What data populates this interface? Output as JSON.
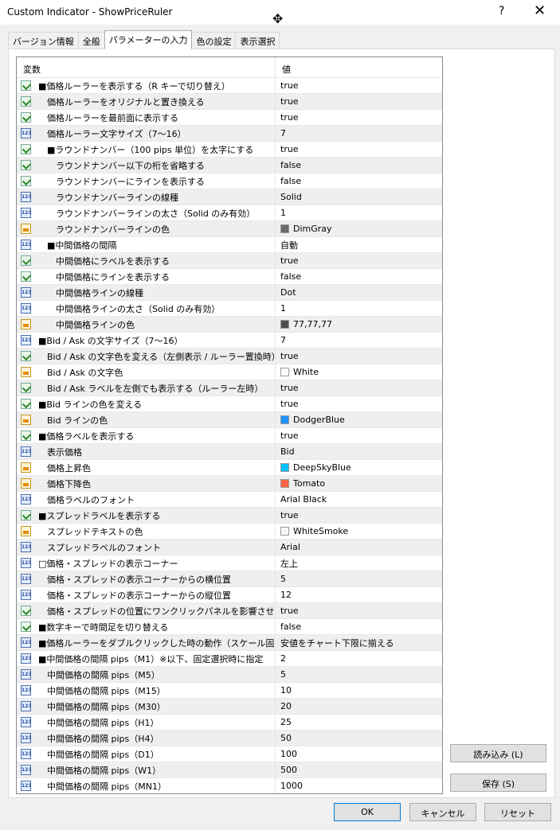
{
  "window": {
    "title": "Custom Indicator - ShowPriceRuler",
    "help_label": "?",
    "close_label": "✕"
  },
  "tabs": [
    {
      "label": "バージョン情報"
    },
    {
      "label": "全般"
    },
    {
      "label": "パラメーターの入力"
    },
    {
      "label": "色の設定"
    },
    {
      "label": "表示選択"
    }
  ],
  "active_tab": 2,
  "grid": {
    "header_variable": "変数",
    "header_value": "値",
    "rows": [
      {
        "icon": "bool-icon",
        "indent": 0,
        "name": "■価格ルーラーを表示する（R キーで切り替え）",
        "value": "true"
      },
      {
        "icon": "bool-icon",
        "indent": 1,
        "name": "価格ルーラーをオリジナルと置き換える",
        "value": "true"
      },
      {
        "icon": "bool-icon",
        "indent": 1,
        "name": "価格ルーラーを最前面に表示する",
        "value": "true"
      },
      {
        "icon": "number-icon",
        "indent": 1,
        "name": "価格ルーラー文字サイズ（7〜16）",
        "value": "7"
      },
      {
        "icon": "bool-icon",
        "indent": 1,
        "name": "■ラウンドナンバー（100 pips 単位）を太字にする",
        "value": "true"
      },
      {
        "icon": "bool-icon",
        "indent": 2,
        "name": "ラウンドナンバー以下の桁を省略する",
        "value": "false"
      },
      {
        "icon": "bool-icon",
        "indent": 2,
        "name": "ラウンドナンバーにラインを表示する",
        "value": "false"
      },
      {
        "icon": "number-icon",
        "indent": 2,
        "name": "ラウンドナンバーラインの線種",
        "value": "Solid"
      },
      {
        "icon": "number-icon",
        "indent": 2,
        "name": "ラウンドナンバーラインの太さ（Solid のみ有効）",
        "value": "1"
      },
      {
        "icon": "color-icon",
        "indent": 2,
        "name": "ラウンドナンバーラインの色",
        "value": "DimGray",
        "swatch": "#696969"
      },
      {
        "icon": "number-icon",
        "indent": 1,
        "name": "■中間価格の間隔",
        "value": "自動"
      },
      {
        "icon": "bool-icon",
        "indent": 2,
        "name": "中間価格にラベルを表示する",
        "value": "true"
      },
      {
        "icon": "bool-icon",
        "indent": 2,
        "name": "中間価格にラインを表示する",
        "value": "false"
      },
      {
        "icon": "number-icon",
        "indent": 2,
        "name": "中間価格ラインの線種",
        "value": "Dot"
      },
      {
        "icon": "number-icon",
        "indent": 2,
        "name": "中間価格ラインの太さ（Solid のみ有効）",
        "value": "1"
      },
      {
        "icon": "color-icon",
        "indent": 2,
        "name": "中間価格ラインの色",
        "value": "77,77,77",
        "swatch": "#4d4d4d"
      },
      {
        "icon": "number-icon",
        "indent": 0,
        "name": "■Bid / Ask の文字サイズ（7〜16）",
        "value": "7"
      },
      {
        "icon": "bool-icon",
        "indent": 1,
        "name": "Bid / Ask の文字色を変える（左側表示 / ルーラー置換時）",
        "value": "true"
      },
      {
        "icon": "color-icon",
        "indent": 1,
        "name": "Bid / Ask の文字色",
        "value": "White",
        "swatch": "#ffffff"
      },
      {
        "icon": "bool-icon",
        "indent": 1,
        "name": "Bid / Ask ラベルを左側でも表示する（ルーラー左時）",
        "value": "true"
      },
      {
        "icon": "bool-icon",
        "indent": 0,
        "name": "■Bid ラインの色を変える",
        "value": "true"
      },
      {
        "icon": "color-icon",
        "indent": 1,
        "name": "Bid ラインの色",
        "value": "DodgerBlue",
        "swatch": "#1e90ff"
      },
      {
        "icon": "bool-icon",
        "indent": 0,
        "name": "■価格ラベルを表示する",
        "value": "true"
      },
      {
        "icon": "number-icon",
        "indent": 1,
        "name": "表示価格",
        "value": "Bid"
      },
      {
        "icon": "color-icon",
        "indent": 1,
        "name": "価格上昇色",
        "value": "DeepSkyBlue",
        "swatch": "#00bfff"
      },
      {
        "icon": "color-icon",
        "indent": 1,
        "name": "価格下降色",
        "value": "Tomato",
        "swatch": "#ff6347"
      },
      {
        "icon": "number-icon",
        "indent": 1,
        "name": "価格ラベルのフォント",
        "value": "Arial Black"
      },
      {
        "icon": "bool-icon",
        "indent": 0,
        "name": "■スプレッドラベルを表示する",
        "value": "true"
      },
      {
        "icon": "color-icon",
        "indent": 1,
        "name": "スプレッドテキストの色",
        "value": "WhiteSmoke",
        "swatch": "#f5f5f5"
      },
      {
        "icon": "number-icon",
        "indent": 1,
        "name": "スプレッドラベルのフォント",
        "value": "Arial"
      },
      {
        "icon": "number-icon",
        "indent": 0,
        "name": "□価格・スプレッドの表示コーナー",
        "value": "左上"
      },
      {
        "icon": "number-icon",
        "indent": 1,
        "name": "価格・スプレッドの表示コーナーからの横位置",
        "value": "5"
      },
      {
        "icon": "number-icon",
        "indent": 1,
        "name": "価格・スプレッドの表示コーナーからの縦位置",
        "value": "12"
      },
      {
        "icon": "bool-icon",
        "indent": 1,
        "name": "価格・スプレッドの位置にワンクリックパネルを影響させる",
        "value": "true"
      },
      {
        "icon": "bool-icon",
        "indent": 0,
        "name": "■数字キーで時間足を切り替える",
        "value": "false"
      },
      {
        "icon": "number-icon",
        "indent": 0,
        "name": "■価格ルーラーをダブルクリックした時の動作（スケール固定時）",
        "value": "安値をチャート下限に揃える"
      },
      {
        "icon": "number-icon",
        "indent": 0,
        "name": "■中間価格の間隔 pips（M1）※以下、固定選択時に指定",
        "value": "2"
      },
      {
        "icon": "number-icon",
        "indent": 1,
        "name": "中間価格の間隔 pips（M5）",
        "value": "5"
      },
      {
        "icon": "number-icon",
        "indent": 1,
        "name": "中間価格の間隔 pips（M15）",
        "value": "10"
      },
      {
        "icon": "number-icon",
        "indent": 1,
        "name": "中間価格の間隔 pips（M30）",
        "value": "20"
      },
      {
        "icon": "number-icon",
        "indent": 1,
        "name": "中間価格の間隔 pips（H1）",
        "value": "25"
      },
      {
        "icon": "number-icon",
        "indent": 1,
        "name": "中間価格の間隔 pips（H4）",
        "value": "50"
      },
      {
        "icon": "number-icon",
        "indent": 1,
        "name": "中間価格の間隔 pips（D1）",
        "value": "100"
      },
      {
        "icon": "number-icon",
        "indent": 1,
        "name": "中間価格の間隔 pips（W1）",
        "value": "500"
      },
      {
        "icon": "number-icon",
        "indent": 1,
        "name": "中間価格の間隔 pips（MN1）",
        "value": "1000"
      }
    ]
  },
  "side_buttons": {
    "load_label": "読み込み (L)",
    "save_label": "保存 (S)"
  },
  "footer_buttons": {
    "ok_label": "OK",
    "cancel_label": "キャンセル",
    "reset_label": "リセット"
  }
}
